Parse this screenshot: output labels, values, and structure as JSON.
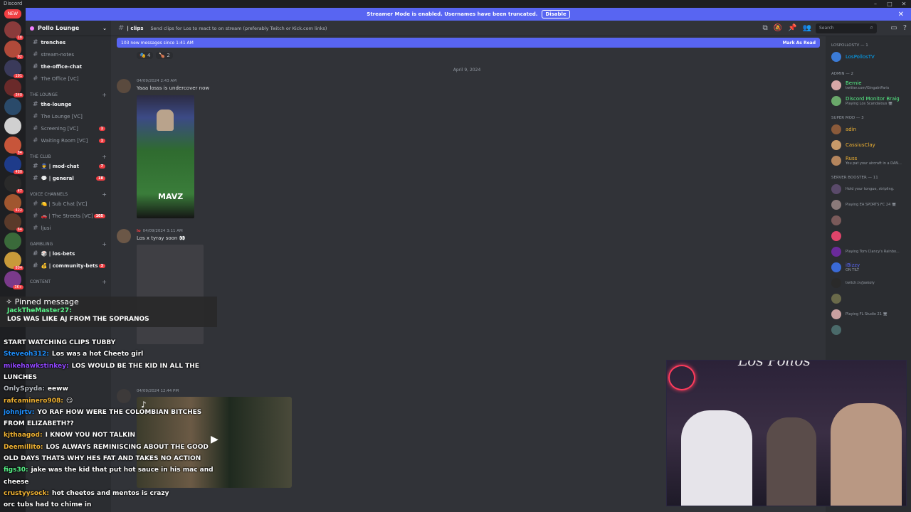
{
  "window": {
    "title": "Discord",
    "minimize": "–",
    "maximize": "□",
    "close": "✕"
  },
  "banner": {
    "text": "Streamer Mode is enabled. Usernames have been truncated.",
    "button": "Disable",
    "close": "✕"
  },
  "servers": {
    "new_label": "NEW",
    "badges": [
      "18",
      "92",
      "191",
      "340",
      "",
      "",
      "84",
      "480",
      "47",
      "422",
      "64",
      "",
      "804",
      "3K+"
    ]
  },
  "server_name": "Pollo Lounge",
  "channels": {
    "top": [
      {
        "name": "trenches",
        "unread": true
      },
      {
        "name": "stream-notes",
        "unread": false
      },
      {
        "name": "the-office-chat",
        "unread": true
      },
      {
        "name": "The Office [VC]",
        "unread": false
      }
    ],
    "cat_lounge": "THE LOUNGE",
    "lounge": [
      {
        "name": "the-lounge",
        "unread": true,
        "count": ""
      },
      {
        "name": "The Lounge [VC]",
        "unread": false,
        "count": ""
      },
      {
        "name": "Screening [VC]",
        "unread": false,
        "count": "1"
      },
      {
        "name": "Waiting Room [VC]",
        "unread": false,
        "count": "1"
      }
    ],
    "cat_club": "THE CLUB",
    "club": [
      {
        "name": "👮 | mod-chat",
        "unread": true,
        "count": "7"
      },
      {
        "name": "💬 | general",
        "unread": true,
        "count": "18"
      }
    ],
    "cat_voice": "VOICE CHANNELS",
    "voice": [
      {
        "name": "🍋 | Sub Chat [VC]",
        "unread": false,
        "count": ""
      },
      {
        "name": "🚗 | The Streets [VC]",
        "unread": false,
        "count": "105"
      },
      {
        "name": "ljusi",
        "unread": false,
        "count": ""
      }
    ],
    "cat_gambling": "GAMBLING",
    "gambling": [
      {
        "name": "🎲 | los-bets",
        "unread": true,
        "count": ""
      },
      {
        "name": "💰 | community-bets",
        "unread": true,
        "count": "3"
      }
    ],
    "cat_content": "CONTENT"
  },
  "topbar": {
    "channel": "| clips",
    "topic": "Send clips for Los to react to on stream (preferably Twitch or Kick.com links)",
    "search_placeholder": "Search"
  },
  "new_messages": {
    "text": "103 new messages since 1:41 AM",
    "mark": "Mark As Read"
  },
  "chat": {
    "reactions": [
      "🎭 4",
      "🍗 2"
    ],
    "date_divider": "April 9, 2024",
    "messages": [
      {
        "user": "",
        "time": "04/09/2024 2:43 AM",
        "text": "Yaaa losss is undercover now"
      },
      {
        "user": "lo",
        "time": "04/09/2024 3:11 AM",
        "text": "Los x tyray soon 👀"
      },
      {
        "user": "",
        "time": "04/09/2024 12:44 PM",
        "text": ""
      }
    ],
    "clip_label": "MAVZ"
  },
  "members": {
    "groups": [
      {
        "title": "LOSPOLLOSTV — 1",
        "items": [
          {
            "name": "LosPollosTV",
            "status": "",
            "color": "#00a8fc"
          }
        ]
      },
      {
        "title": "ADMIN — 2",
        "items": [
          {
            "name": "Bernie",
            "status": "twitter.com/GingaInParis",
            "color": "#57f287"
          },
          {
            "name": "Discord Monitor Braig",
            "status": "Playing Los Scandalous 🖥",
            "color": "#57f287"
          }
        ]
      },
      {
        "title": "SUPER MOD — 3",
        "items": [
          {
            "name": "adin",
            "status": "",
            "color": "#f0b232"
          },
          {
            "name": "CassiusClay",
            "status": "",
            "color": "#f0b232"
          },
          {
            "name": "Russ",
            "status": "You pat your aircraft in a DAN...",
            "color": "#f0b232"
          }
        ]
      },
      {
        "title": "SERVER BOOSTER — 11",
        "items": [
          {
            "name": "",
            "status": "Hold your tongue, stripling.",
            "color": "#f47fff"
          },
          {
            "name": "",
            "status": "Playing EA SPORTS FC 24 🖥",
            "color": "#f47fff"
          },
          {
            "name": "",
            "status": "",
            "color": "#f47fff"
          },
          {
            "name": "",
            "status": "",
            "color": "#f47fff"
          },
          {
            "name": "",
            "status": "Playing Tom Clancy's Rainbo...",
            "color": "#f47fff"
          },
          {
            "name": "iBizzy",
            "status": "ON TILT",
            "color": "#5865f2"
          },
          {
            "name": "",
            "status": "twitch.tv/Jaskoly",
            "color": "#f47fff"
          },
          {
            "name": "",
            "status": "",
            "color": "#f47fff"
          },
          {
            "name": "",
            "status": "Playing FL Studio 21 🖥",
            "color": "#f47fff"
          },
          {
            "name": "",
            "status": "",
            "color": "#f47fff"
          }
        ]
      }
    ]
  },
  "overlay": {
    "pinned_title": "Pinned message",
    "pinned_user": "JackTheMaster27:",
    "pinned_text": "LOS WAS LIKE AJ FROM THE SOPRANOS",
    "lines": [
      {
        "user": "",
        "text": "START WATCHING CLIPS TUBBY",
        "color": "#e91e63"
      },
      {
        "user": "Steveoh312:",
        "text": "Los was a hot Cheeto girl",
        "color": "#1e90ff"
      },
      {
        "user": "mikehawkstinkey:",
        "text": "LOS WOULD BE THE KID IN ALL THE",
        "color": "#9146ff"
      },
      {
        "user": "",
        "text": "LUNCHES",
        "color": "#ffffff"
      },
      {
        "user": "OnlySpyda:",
        "text": "eeww",
        "color": "#b5bac1"
      },
      {
        "user": "rafcaminero908:",
        "text": "😏",
        "color": "#f0b232"
      },
      {
        "user": "johnjrtv:",
        "text": "YO RAF HOW WERE THE COLOMBIAN BITCHES",
        "color": "#1e90ff"
      },
      {
        "user": "",
        "text": "FROM ELIZABETH??",
        "color": "#ffffff"
      },
      {
        "user": "kjthaagod:",
        "text": "I KNOW YOU NOT TALKIN",
        "color": "#f0b232"
      },
      {
        "user": "Deemillito:",
        "text": "LOS ALWAYS REMINISCING ABOUT THE GOOD",
        "color": "#f0b232"
      },
      {
        "user": "",
        "text": "OLD DAYS THATS WHY HES FAT AND TAKES NO ACTION",
        "color": "#ffffff"
      },
      {
        "user": "figs30:",
        "text": "jake was the kid that put hot sauce in his mac and",
        "color": "#57f287"
      },
      {
        "user": "",
        "text": "cheese",
        "color": "#ffffff"
      },
      {
        "user": "crustyysock:",
        "text": "hot cheetos and mentos is crazy",
        "color": "#f0b232"
      },
      {
        "user": "",
        "text": "orc tubs had to chime in",
        "color": "#e91e63"
      }
    ]
  },
  "webcam": {
    "signature": "Los Pollos"
  },
  "colors": {
    "accent": "#5865f2",
    "danger": "#f23f43",
    "bg": "#313338"
  }
}
